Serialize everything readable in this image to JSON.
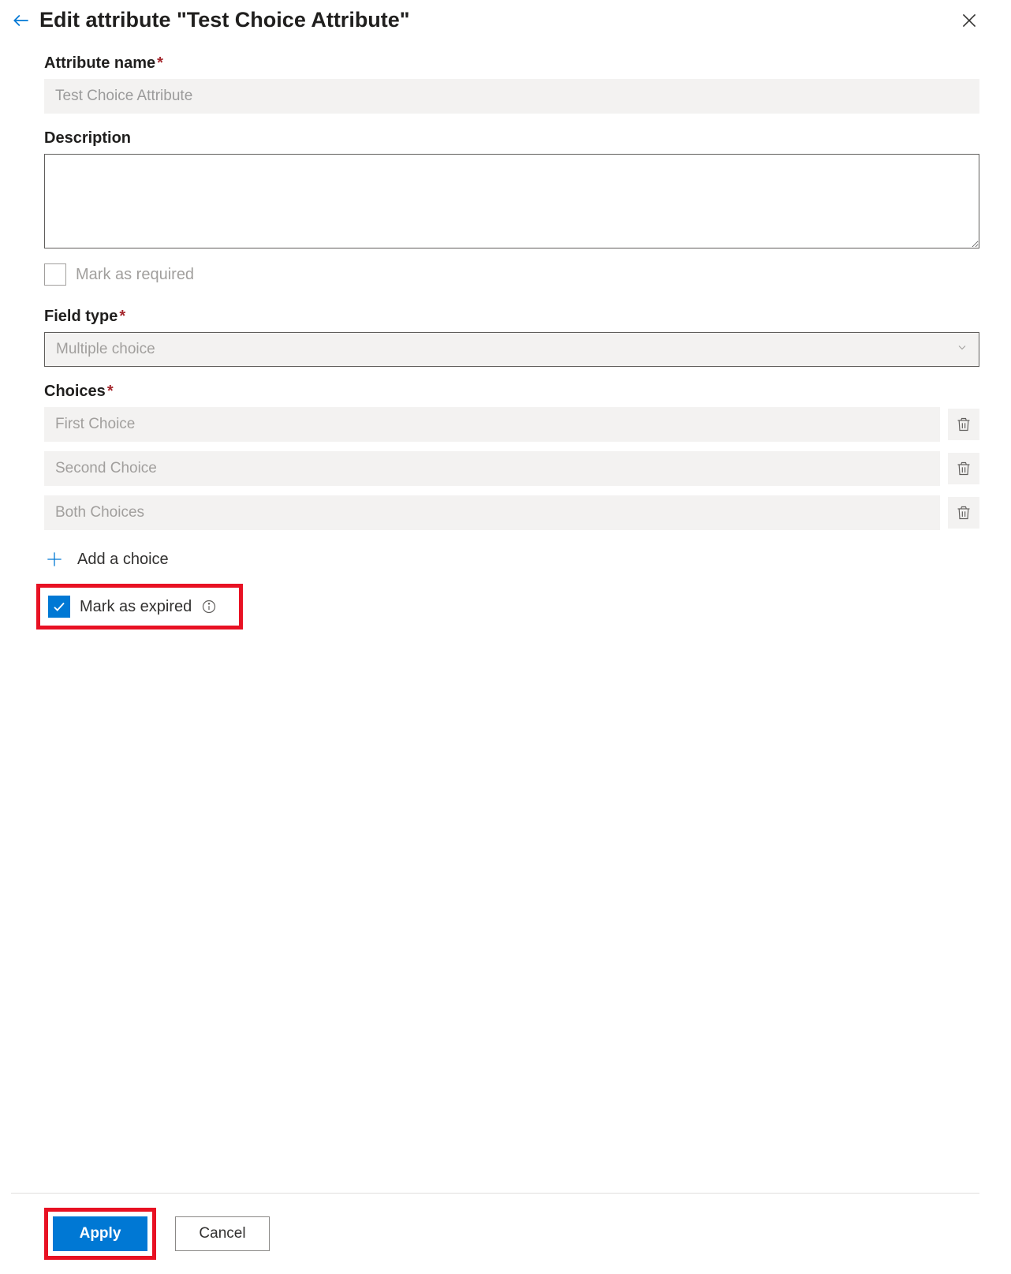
{
  "header": {
    "title": "Edit attribute \"Test Choice Attribute\""
  },
  "form": {
    "attribute_name": {
      "label": "Attribute name",
      "value": "Test Choice Attribute"
    },
    "description": {
      "label": "Description",
      "value": ""
    },
    "mark_required": {
      "label": "Mark as required",
      "checked": false
    },
    "field_type": {
      "label": "Field type",
      "selected": "Multiple choice"
    },
    "choices": {
      "label": "Choices",
      "items": [
        "First Choice",
        "Second Choice",
        "Both Choices"
      ],
      "add_label": "Add a choice"
    },
    "mark_expired": {
      "label": "Mark as expired",
      "checked": true
    }
  },
  "footer": {
    "apply": "Apply",
    "cancel": "Cancel"
  }
}
